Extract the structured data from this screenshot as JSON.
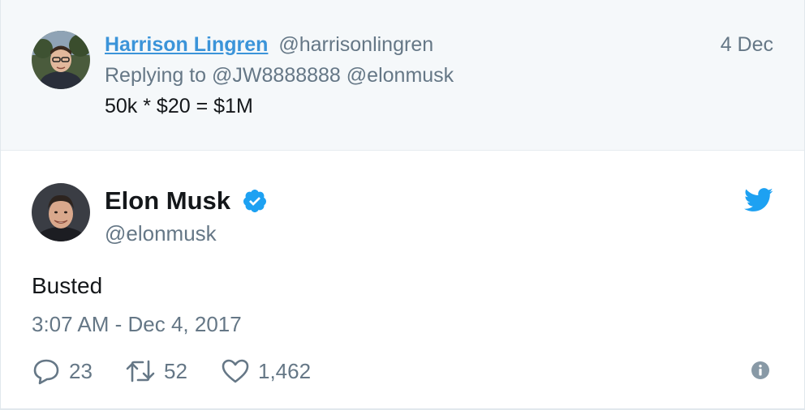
{
  "parent_tweet": {
    "author_name": "Harrison Lingren",
    "author_handle": "@harrisonlingren",
    "date": "4 Dec",
    "replying_prefix": "Replying to",
    "replying_to": [
      "@JW8888888",
      "@elonmusk"
    ],
    "text": "50k * $20 = $1M",
    "avatar_icon": "person-avatar-photo"
  },
  "tweet": {
    "author_name": "Elon Musk",
    "author_handle": "@elonmusk",
    "verified": true,
    "text": "Busted",
    "timestamp": "3:07 AM - Dec 4, 2017",
    "avatar_icon": "person-avatar-photo",
    "brand_icon": "twitter-bird-icon"
  },
  "actions": {
    "replies": "23",
    "retweets": "52",
    "likes": "1,462"
  },
  "colors": {
    "link_blue": "#3b94d9",
    "twitter_blue": "#1da1f2",
    "muted_gray": "#657786",
    "text_dark": "#14171a",
    "parent_background": "#f5f8fa"
  }
}
